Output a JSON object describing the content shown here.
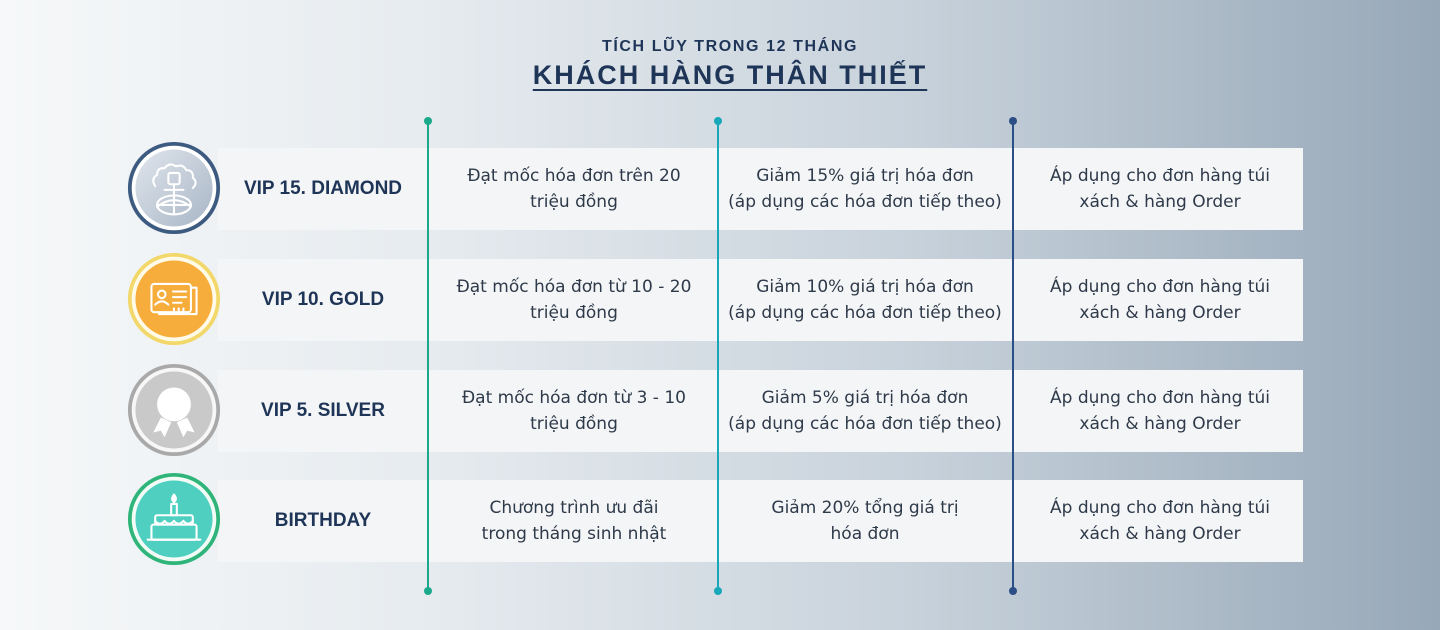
{
  "header": {
    "subtitle": "TÍCH LŨY TRONG 12 THÁNG",
    "title": "KHÁCH HÀNG THÂN THIẾT"
  },
  "colors": {
    "line_green": "#1aa98a",
    "line_teal": "#17a8b9",
    "line_navy": "#2c4e86",
    "diamond_ring": "#3d5a80",
    "gold_ring": "#f2d86a",
    "silver_ring": "#a9a9a9",
    "birthday_ring": "#2fb57a"
  },
  "tiers": [
    {
      "icon": "diamond-globe-icon",
      "label": "VIP 15. DIAMOND",
      "condition": "Đạt mốc hóa đơn trên 20\ntriệu đồng",
      "benefit": "Giảm 15% giá trị hóa đơn\n(áp dụng các hóa đơn tiếp theo)",
      "scope": "Áp dụng cho đơn hàng túi\nxách & hàng Order"
    },
    {
      "icon": "id-card-icon",
      "label": "VIP 10. GOLD",
      "condition": "Đạt mốc hóa đơn từ 10 - 20\ntriệu đồng",
      "benefit": "Giảm 10% giá trị hóa đơn\n(áp dụng các hóa đơn tiếp theo)",
      "scope": "Áp dụng cho đơn hàng túi\nxách & hàng Order"
    },
    {
      "icon": "award-ribbon-icon",
      "label": "VIP 5. SILVER",
      "condition": "Đạt mốc hóa đơn từ 3 - 10\ntriệu đồng",
      "benefit": "Giảm 5% giá trị hóa đơn\n(áp dụng các hóa đơn tiếp theo)",
      "scope": "Áp dụng cho đơn hàng túi\nxách & hàng Order"
    },
    {
      "icon": "birthday-cake-icon",
      "label": "BIRTHDAY",
      "condition": "Chương trình ưu đãi\ntrong tháng sinh nhật",
      "benefit": "Giảm 20% tổng giá trị\nhóa đơn",
      "scope": "Áp dụng cho đơn hàng túi\nxách & hàng Order"
    }
  ]
}
